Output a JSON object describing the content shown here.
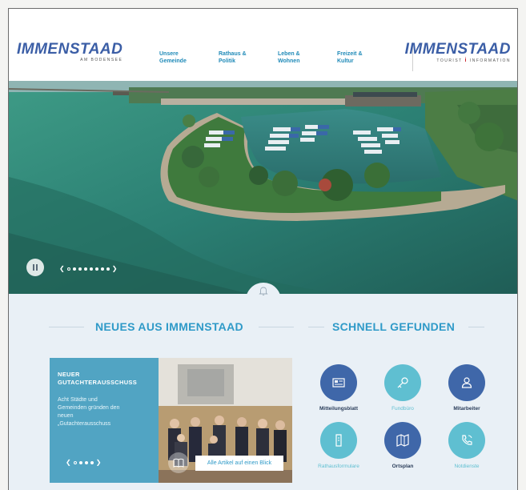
{
  "header": {
    "logo_left": {
      "text": "IMMENSTAAD",
      "tagline": "AM BODENSEE"
    },
    "logo_right": {
      "text": "IMMENSTAAD",
      "tagline_a": "TOURIST",
      "tagline_i": "i",
      "tagline_b": "INFORMATION"
    },
    "nav": [
      {
        "line1": "Unsere",
        "line2": "Gemeinde"
      },
      {
        "line1": "Rathaus &",
        "line2": "Politik"
      },
      {
        "line1": "Leben &",
        "line2": "Wohnen"
      },
      {
        "line1": "Freizeit &",
        "line2": "Kultur"
      }
    ]
  },
  "hero": {
    "slide_count": 8,
    "active_slide": 1
  },
  "sections": {
    "news_title": "NEUES AUS IMMENSTAAD",
    "quick_title": "SCHNELL GEFUNDEN"
  },
  "news": {
    "title_line1": "NEUER",
    "title_line2": "GUTACHTERAUSSCHUSS",
    "text_lines": [
      "Acht Städte und",
      "Gemeinden gründen den",
      "neuen",
      "„Gutachterausschuss"
    ],
    "link_label": "Alle Artikel auf einen Blick",
    "slide_count": 4,
    "active_slide": 1
  },
  "quick_links": [
    {
      "label": "Mitteilungsblatt",
      "icon": "newspaper-icon",
      "style": "dark"
    },
    {
      "label": "Fundbüro",
      "icon": "key-icon",
      "style": "light"
    },
    {
      "label": "Mitarbeiter",
      "icon": "person-icon",
      "style": "dark"
    },
    {
      "label": "Rathausformulare",
      "icon": "document-icon",
      "style": "light"
    },
    {
      "label": "Ortsplan",
      "icon": "map-icon",
      "style": "dark"
    },
    {
      "label": "Notdienste",
      "icon": "phone-icon",
      "style": "light"
    }
  ],
  "colors": {
    "accent": "#2f9ac8",
    "dark_circle": "#3f67a9",
    "light_circle": "#5fbfd1",
    "section_bg": "#e9f0f6",
    "logo_blue": "#3b5ea6",
    "logo_red": "#d9262c"
  }
}
